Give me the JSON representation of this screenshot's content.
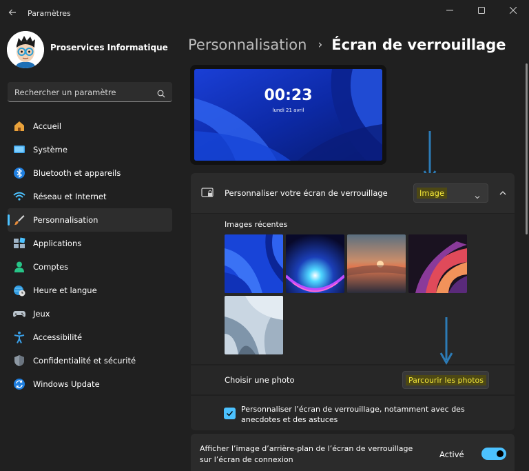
{
  "window": {
    "title": "Paramètres"
  },
  "profile": {
    "name": "Proservices Informatique"
  },
  "search": {
    "placeholder": "Rechercher un paramètre"
  },
  "sidebar": {
    "items": [
      {
        "label": "Accueil",
        "icon": "home-icon",
        "active": false
      },
      {
        "label": "Système",
        "icon": "system-icon",
        "active": false
      },
      {
        "label": "Bluetooth et appareils",
        "icon": "bluetooth-icon",
        "active": false
      },
      {
        "label": "Réseau et Internet",
        "icon": "wifi-icon",
        "active": false
      },
      {
        "label": "Personnalisation",
        "icon": "brush-icon",
        "active": true
      },
      {
        "label": "Applications",
        "icon": "apps-icon",
        "active": false
      },
      {
        "label": "Comptes",
        "icon": "person-icon",
        "active": false
      },
      {
        "label": "Heure et langue",
        "icon": "globe-clock-icon",
        "active": false
      },
      {
        "label": "Jeux",
        "icon": "gamepad-icon",
        "active": false
      },
      {
        "label": "Accessibilité",
        "icon": "accessibility-icon",
        "active": false
      },
      {
        "label": "Confidentialité et sécurité",
        "icon": "shield-icon",
        "active": false
      },
      {
        "label": "Windows Update",
        "icon": "update-icon",
        "active": false
      }
    ]
  },
  "breadcrumb": {
    "parent": "Personnalisation",
    "separator": "›",
    "current": "Écran de verrouillage"
  },
  "preview": {
    "time": "00:23",
    "date": "lundi 21 avril"
  },
  "lockscreen": {
    "label": "Personnaliser votre écran de verrouillage",
    "dropdown_value": "Image",
    "recent_label": "Images récentes",
    "choose_label": "Choisir une photo",
    "browse_label": "Parcourir les photos",
    "tips_label": "Personnaliser l’écran de verrouillage, notamment avec des anecdotes et des astuces",
    "tips_checked": true
  },
  "signin": {
    "label": "Afficher l’image d’arrière-plan de l’écran de verrouillage sur l’écran de connexion",
    "toggle_label": "Activé",
    "toggle_on": true
  },
  "colors": {
    "accent": "#4cc2ff",
    "highlight_text": "#f5e93a",
    "highlight_bg": "#4d4814",
    "annotation_arrow": "#2c7bb6"
  }
}
